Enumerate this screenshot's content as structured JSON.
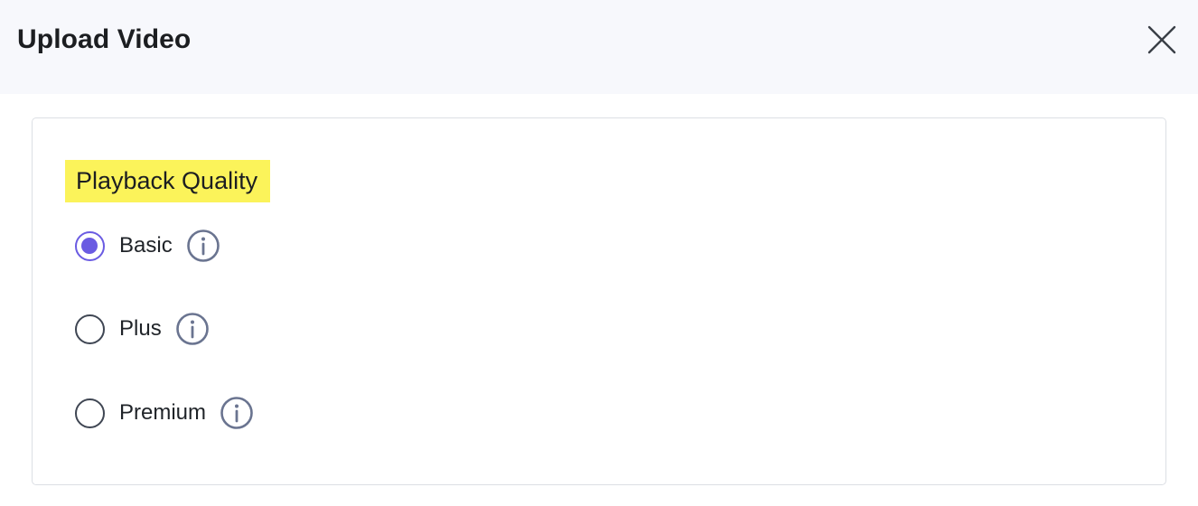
{
  "dialog": {
    "title": "Upload Video",
    "close_icon": "close-icon"
  },
  "playback_quality": {
    "heading": "Playback Quality",
    "highlight_color": "#fbf35a",
    "accent_color": "#6a5be2",
    "selected": "Basic",
    "options": [
      {
        "label": "Basic",
        "checked": true,
        "icon": "info-icon"
      },
      {
        "label": "Plus",
        "checked": false,
        "icon": "info-icon"
      },
      {
        "label": "Premium",
        "checked": false,
        "icon": "info-icon"
      }
    ]
  }
}
